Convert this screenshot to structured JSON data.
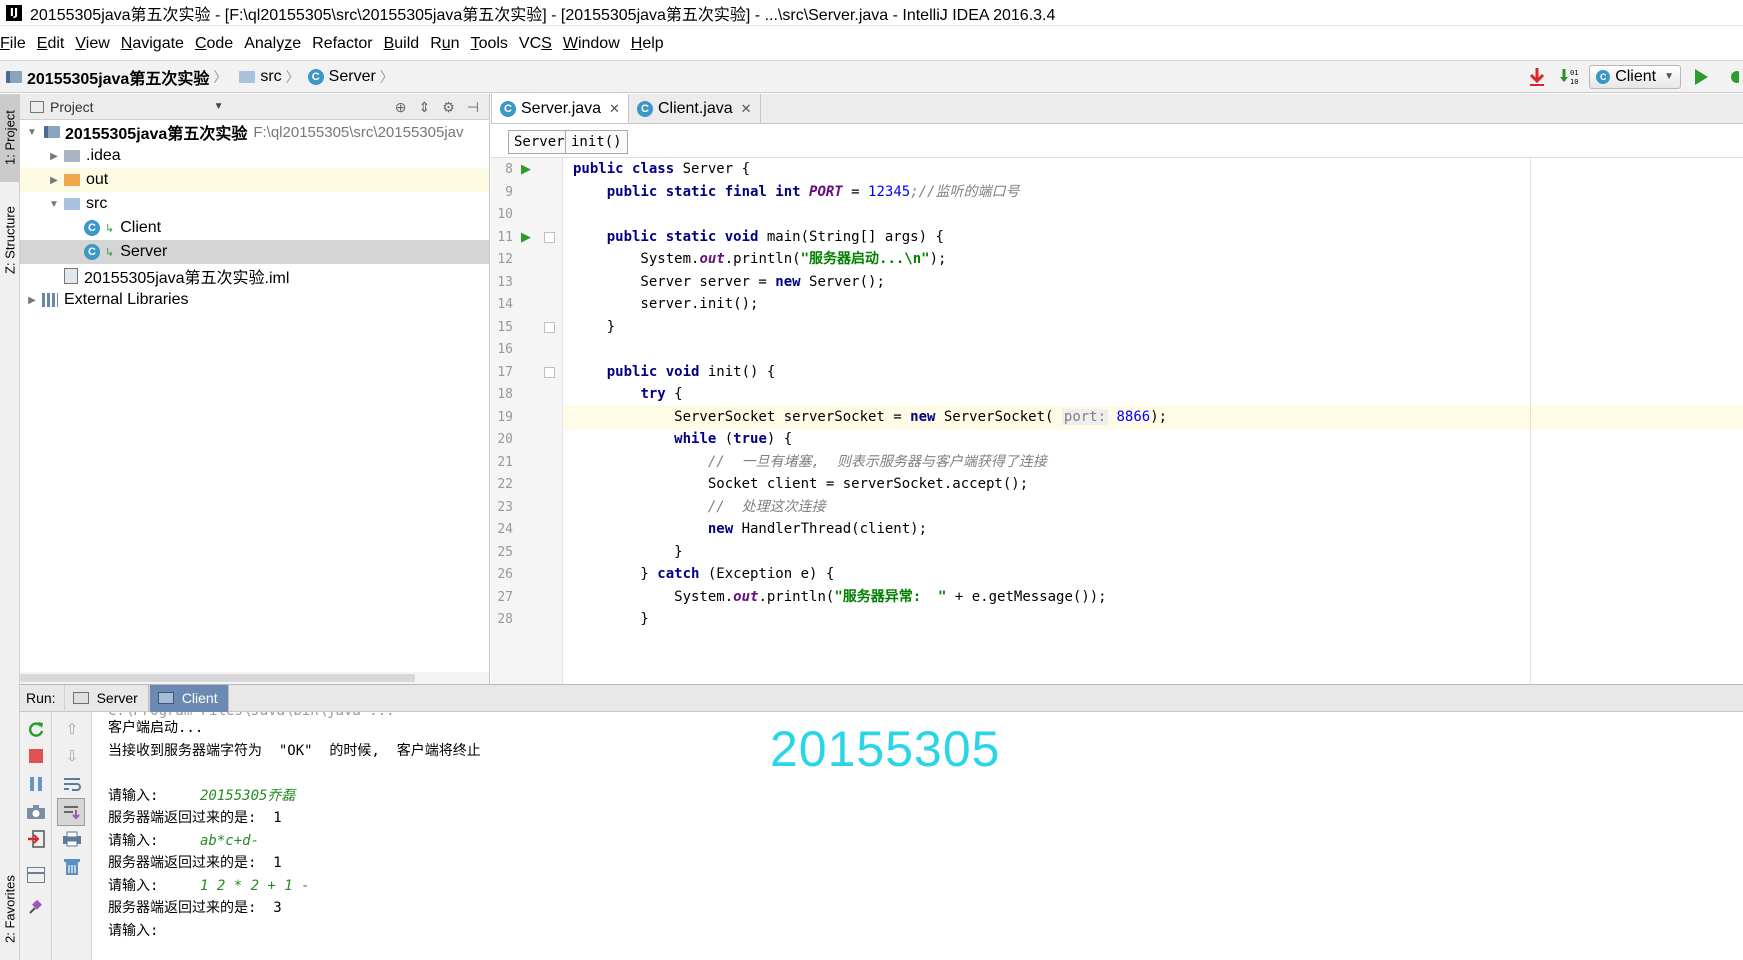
{
  "window": {
    "title": "20155305java第五次实验 - [F:\\ql20155305\\src\\20155305java第五次实验] - [20155305java第五次实验] - ...\\src\\Server.java - IntelliJ IDEA 2016.3.4",
    "app_icon": "IJ"
  },
  "menu": [
    {
      "u": "F",
      "rest": "ile"
    },
    {
      "u": "E",
      "rest": "dit"
    },
    {
      "u": "V",
      "rest": "iew"
    },
    {
      "u": "N",
      "rest": "avigate"
    },
    {
      "u": "C",
      "rest": "ode"
    },
    {
      "u": "",
      "rest": "Analy",
      "u2": "z",
      "rest2": "e"
    },
    {
      "u": "",
      "rest": "Refactor"
    },
    {
      "u": "B",
      "rest": "uild"
    },
    {
      "u": "",
      "rest": "R",
      "u2": "u",
      "rest2": "n"
    },
    {
      "u": "T",
      "rest": "ools"
    },
    {
      "u": "",
      "rest": "VC",
      "u2": "S",
      "rest2": ""
    },
    {
      "u": "W",
      "rest": "indow"
    },
    {
      "u": "H",
      "rest": "elp"
    }
  ],
  "navbar": {
    "crumbs": [
      "20155305java第五次实验",
      "src",
      "Server"
    ],
    "run_config": "Client",
    "icons": [
      "make-icon",
      "sort-icon",
      "run-icon",
      "debug-icon"
    ]
  },
  "left_strip": {
    "tabs": [
      "1: Project",
      "Z: Structure"
    ],
    "bottom_tab": "2: Favorites"
  },
  "project_panel": {
    "title": "Project",
    "tree": [
      {
        "label": "20155305java第五次实验",
        "path": "F:\\ql20155305\\src\\20155305jav",
        "indent": 0,
        "toggle": "▼",
        "icon": "module-folder"
      },
      {
        "label": ".idea",
        "indent": 1,
        "toggle": "▶",
        "icon": "grey-folder"
      },
      {
        "label": "out",
        "indent": 1,
        "toggle": "▶",
        "icon": "orange-folder"
      },
      {
        "label": "src",
        "indent": 1,
        "toggle": "▼",
        "icon": "blue-folder"
      },
      {
        "label": "Client",
        "indent": 2,
        "toggle": "",
        "icon": "class"
      },
      {
        "label": "Server",
        "indent": 2,
        "toggle": "",
        "icon": "class"
      },
      {
        "label": "20155305java第五次实验.iml",
        "indent": 1,
        "toggle": "",
        "icon": "iml"
      },
      {
        "label": "External Libraries",
        "indent": 0,
        "toggle": "▶",
        "icon": "library"
      }
    ]
  },
  "editor": {
    "tabs": [
      {
        "label": "Server.java",
        "active": true
      },
      {
        "label": "Client.java",
        "active": false
      }
    ],
    "crumbs": [
      "Server",
      "init()"
    ],
    "first_line": 8,
    "current_line": 19,
    "run_marks": [
      8,
      11
    ],
    "fold_marks": [
      11,
      15,
      17
    ],
    "lines": [
      [
        [
          "kw",
          "public class "
        ],
        [
          "",
          "Server {"
        ]
      ],
      [
        [
          "",
          "    "
        ],
        [
          "kw",
          "public static final int "
        ],
        [
          "st",
          "PORT"
        ],
        [
          "",
          " = "
        ],
        [
          "num",
          "12345"
        ],
        [
          "cm",
          ";//监听的端口号"
        ]
      ],
      [],
      [
        [
          "",
          "    "
        ],
        [
          "kw",
          "public static void "
        ],
        [
          "",
          "main(String[] args) {"
        ]
      ],
      [
        [
          "",
          "        System."
        ],
        [
          "st",
          "out"
        ],
        [
          "",
          ".println("
        ],
        [
          "str",
          "\"服务器启动...\\n\""
        ],
        [
          "",
          ");"
        ]
      ],
      [
        [
          "",
          "        Server server = "
        ],
        [
          "kw",
          "new "
        ],
        [
          "",
          "Server();"
        ]
      ],
      [
        [
          "",
          "        server.init();"
        ]
      ],
      [
        [
          "",
          "    }"
        ]
      ],
      [],
      [
        [
          "",
          "    "
        ],
        [
          "kw",
          "public void "
        ],
        [
          "",
          "init() {"
        ]
      ],
      [
        [
          "",
          "        "
        ],
        [
          "kw",
          "try "
        ],
        [
          "",
          "{"
        ]
      ],
      [
        [
          "",
          "            ServerSocket serverSocket = "
        ],
        [
          "kw",
          "new "
        ],
        [
          "",
          "ServerSocket( "
        ],
        [
          "hint",
          "port:"
        ],
        [
          "",
          " "
        ],
        [
          "num",
          "8866"
        ],
        [
          "",
          ");"
        ]
      ],
      [
        [
          "",
          "            "
        ],
        [
          "kw",
          "while "
        ],
        [
          "",
          "("
        ],
        [
          "kw",
          "true"
        ],
        [
          "",
          ") {"
        ]
      ],
      [
        [
          "",
          "                "
        ],
        [
          "cm",
          "//  一旦有堵塞,  则表示服务器与客户端获得了连接"
        ]
      ],
      [
        [
          "",
          "                Socket client = serverSocket.accept();"
        ]
      ],
      [
        [
          "",
          "                "
        ],
        [
          "cm",
          "//  处理这次连接"
        ]
      ],
      [
        [
          "",
          "                "
        ],
        [
          "kw",
          "new "
        ],
        [
          "",
          "HandlerThread(client);"
        ]
      ],
      [
        [
          "",
          "            }"
        ]
      ],
      [
        [
          "",
          "        } "
        ],
        [
          "kw",
          "catch "
        ],
        [
          "",
          "(Exception e) {"
        ]
      ],
      [
        [
          "",
          "            System."
        ],
        [
          "st",
          "out"
        ],
        [
          "",
          ".println("
        ],
        [
          "str",
          "\"服务器异常:  \""
        ],
        [
          "",
          " + e.getMessage());"
        ]
      ],
      [
        [
          "",
          "        }"
        ]
      ]
    ]
  },
  "run_panel": {
    "label": "Run:",
    "tabs": [
      {
        "label": "Server",
        "active": false
      },
      {
        "label": "Client",
        "active": true
      }
    ],
    "console_cut": "C:\\Program Files\\Java\\bin\\java ...",
    "console": [
      {
        "text": "客户端启动...",
        "type": "out"
      },
      {
        "text": "当接收到服务器端字符为  \"OK\"  的时候,  客户端将终止",
        "type": "out"
      },
      {
        "text": "",
        "type": "out"
      },
      {
        "text": "请输入:",
        "input": "20155305乔磊",
        "type": "prompt"
      },
      {
        "text": "服务器端返回过来的是:  1",
        "type": "out"
      },
      {
        "text": "请输入:",
        "input": "ab*c+d-",
        "type": "prompt"
      },
      {
        "text": "服务器端返回过来的是:  1",
        "type": "out"
      },
      {
        "text": "请输入:",
        "input": "1 2 * 2 + 1 -",
        "type": "prompt"
      },
      {
        "text": "服务器端返回过来的是:  3",
        "type": "out"
      },
      {
        "text": "请输入:",
        "type": "out"
      }
    ],
    "watermark_id": "20155305"
  },
  "colors": {
    "keyword": "#000080",
    "string": "#008000",
    "comment": "#808080",
    "number": "#0000ff",
    "static_field": "#660e7a",
    "input_text": "#258b25",
    "watermark": "#2ad6e6",
    "active_run_tab": "#6c8ab1"
  }
}
